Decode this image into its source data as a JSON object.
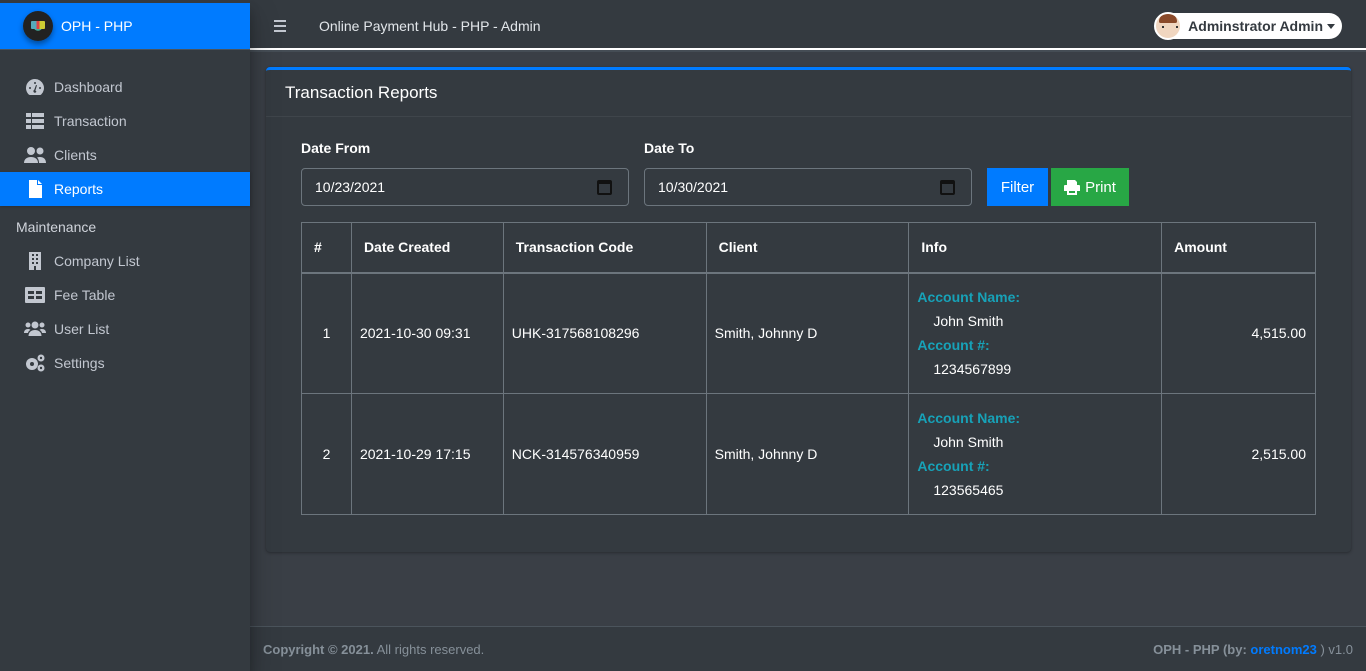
{
  "brand": {
    "name": "OPH - PHP",
    "logo_icon": "app-logo"
  },
  "sidebar": {
    "items": [
      {
        "label": "Dashboard",
        "icon": "tachometer-icon",
        "active": false
      },
      {
        "label": "Transaction",
        "icon": "list-icon",
        "active": false
      },
      {
        "label": "Clients",
        "icon": "user-friends-icon",
        "active": false
      },
      {
        "label": "Reports",
        "icon": "file-icon",
        "active": true
      }
    ],
    "section_header": "Maintenance",
    "maintenance_items": [
      {
        "label": "Company List",
        "icon": "building-icon"
      },
      {
        "label": "Fee Table",
        "icon": "table-icon"
      },
      {
        "label": "User List",
        "icon": "users-icon"
      },
      {
        "label": "Settings",
        "icon": "cogs-icon"
      }
    ]
  },
  "header": {
    "title": "Online Payment Hub - PHP - Admin",
    "user_name": "Adminstrator Admin"
  },
  "card": {
    "title": "Transaction Reports",
    "date_from_label": "Date From",
    "date_from_value": "10/23/2021",
    "date_to_label": "Date To",
    "date_to_value": "10/30/2021",
    "filter_label": "Filter",
    "print_label": "Print"
  },
  "table": {
    "columns": [
      "#",
      "Date Created",
      "Transaction Code",
      "Client",
      "Info",
      "Amount"
    ],
    "info_labels": {
      "account_name": "Account Name:",
      "account_no": "Account #:"
    },
    "rows": [
      {
        "num": "1",
        "date": "2021-10-30 09:31",
        "code": "UHK-317568108296",
        "client": "Smith, Johnny D",
        "account_name": "John Smith",
        "account_no": "1234567899",
        "amount": "4,515.00"
      },
      {
        "num": "2",
        "date": "2021-10-29 17:15",
        "code": "NCK-314576340959",
        "client": "Smith, Johnny D",
        "account_name": "John Smith",
        "account_no": "123565465",
        "amount": "2,515.00"
      }
    ]
  },
  "footer": {
    "copyright_strong": "Copyright © 2021.",
    "copyright_rest": " All rights reserved.",
    "right_prefix": "OPH - PHP (by: ",
    "author_link": "oretnom23",
    "right_suffix": " ) v1.0"
  },
  "colors": {
    "primary": "#007bff",
    "success": "#28a745",
    "info": "#17a2b8",
    "dark": "#343a40"
  }
}
